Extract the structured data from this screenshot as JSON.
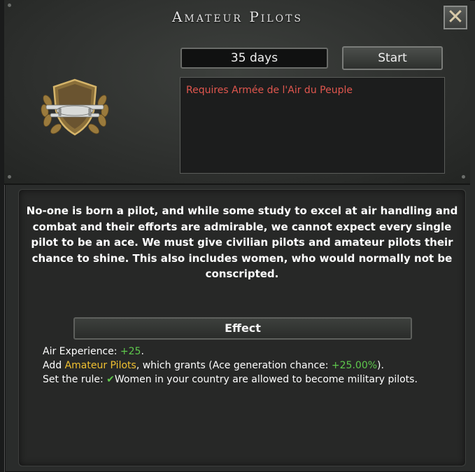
{
  "window": {
    "title": "Amateur Pilots"
  },
  "focus": {
    "duration": "35 days",
    "start_label": "Start",
    "requirement": "Requires Armée de l'Air du Peuple"
  },
  "description": "No-one is born a pilot, and while some study to excel at air handling and combat and their efforts are admirable, we cannot expect every single pilot to be an ace. We must give civilian pilots and amateur pilots their chance to shine. This also includes women, who would normally not be conscripted.",
  "effect": {
    "header": "Effect",
    "air_xp_label": "Air Experience: ",
    "air_xp_value": "+25",
    "air_xp_tail": ".",
    "add_prefix": "Add ",
    "idea_name": "Amateur Pilots",
    "grants_prefix": ", which grants (Ace generation chance: ",
    "grants_value": "+25.00%",
    "grants_suffix": ").",
    "rule_prefix": "Set the rule: ",
    "rule_text": "Women in your country are allowed to become military pilots."
  },
  "colors": {
    "positive": "#5ec94c",
    "highlight": "#f0c030",
    "requirement": "#e0564e"
  },
  "icons": {
    "close": "close-x-icon",
    "emblem": "air-pilot-emblem-icon",
    "check": "checkmark-icon"
  }
}
